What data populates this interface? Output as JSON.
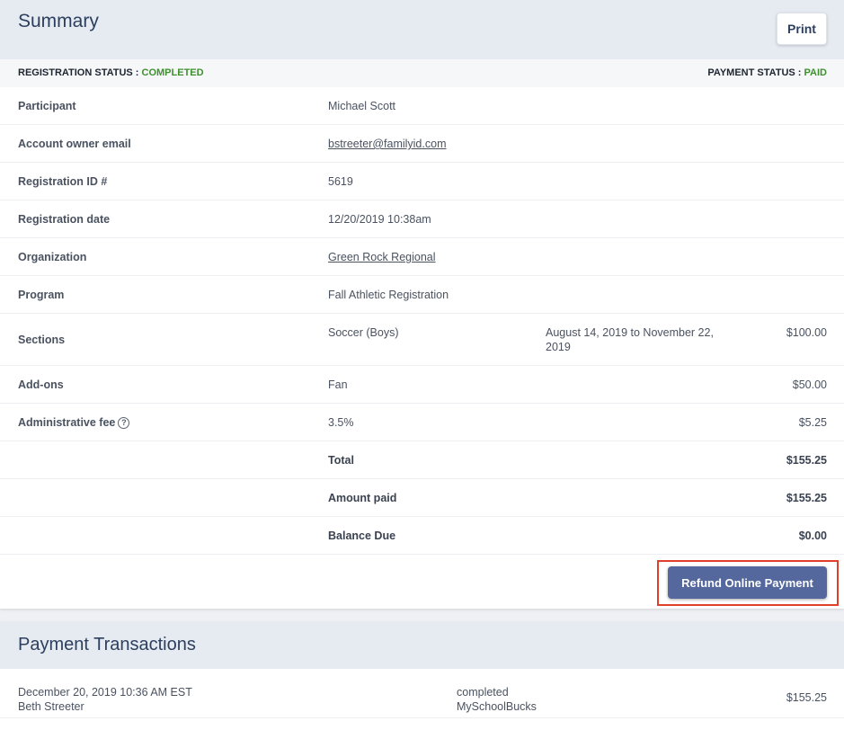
{
  "summary": {
    "title": "Summary",
    "print_label": "Print",
    "registration_status_label": "REGISTRATION STATUS :",
    "registration_status_value": "COMPLETED",
    "payment_status_label": "PAYMENT STATUS :",
    "payment_status_value": "PAID",
    "rows": {
      "participant": {
        "label": "Participant",
        "value": "Michael Scott"
      },
      "email": {
        "label": "Account owner email",
        "value": "bstreeter@familyid.com"
      },
      "registration_id": {
        "label": "Registration ID #",
        "value": "5619"
      },
      "registration_date": {
        "label": "Registration date",
        "value": "12/20/2019 10:38am"
      },
      "organization": {
        "label": "Organization",
        "value": "Green Rock Regional"
      },
      "program": {
        "label": "Program",
        "value": "Fall Athletic Registration"
      },
      "sections": {
        "label": "Sections",
        "value": "Soccer (Boys)",
        "dates": "August 14, 2019 to November 22, 2019",
        "amount": "$100.00"
      },
      "addons": {
        "label": "Add-ons",
        "value": "Fan",
        "amount": "$50.00"
      },
      "admin_fee": {
        "label": "Administrative fee",
        "value": "3.5%",
        "amount": "$5.25",
        "help_icon": "question-circle-icon"
      },
      "total": {
        "label": "Total",
        "amount": "$155.25"
      },
      "amount_paid": {
        "label": "Amount paid",
        "amount": "$155.25"
      },
      "balance_due": {
        "label": "Balance Due",
        "amount": "$0.00"
      }
    },
    "refund_label": "Refund Online Payment"
  },
  "transactions": {
    "title": "Payment Transactions",
    "items": [
      {
        "datetime": "December 20, 2019 10:36 AM EST",
        "payer": "Beth Streeter",
        "status": "completed",
        "method": "MySchoolBucks",
        "amount": "$155.25"
      }
    ]
  },
  "colors": {
    "header_bg": "#e6eaf1",
    "status_green": "#3f8f2f",
    "refund_button": "#54689e",
    "highlight_outline": "#e0402a",
    "link": "#2a5ca8"
  }
}
